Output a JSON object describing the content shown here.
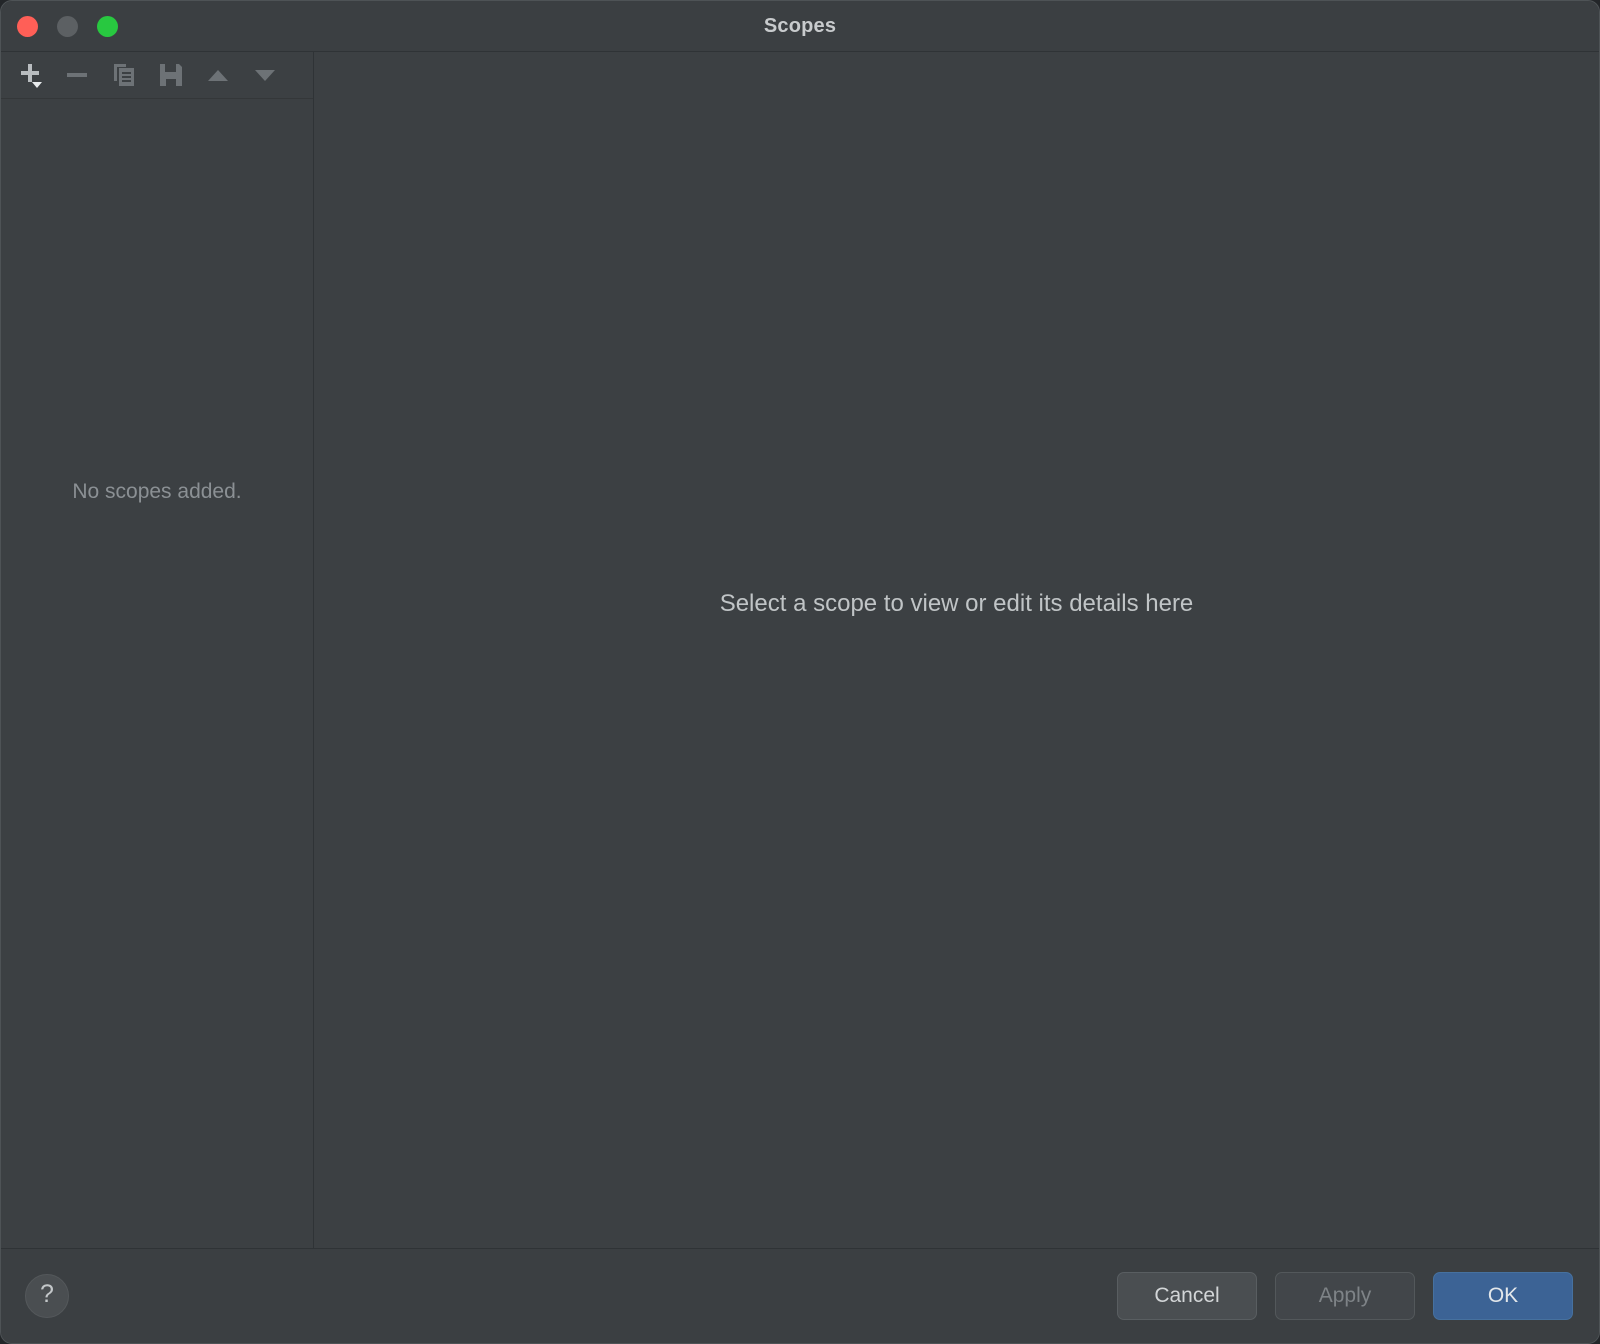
{
  "window": {
    "title": "Scopes",
    "traffic_lights": [
      {
        "name": "close",
        "color": "#ff5f57"
      },
      {
        "name": "minimize",
        "color": "#5c6063"
      },
      {
        "name": "zoom",
        "color": "#28c840"
      }
    ]
  },
  "toolbar": {
    "items": [
      {
        "icon": "add-icon",
        "label": "Add scope",
        "enabled": true,
        "has_dropdown": true
      },
      {
        "icon": "remove-icon",
        "label": "Remove scope",
        "enabled": false,
        "has_dropdown": false
      },
      {
        "icon": "copy-icon",
        "label": "Duplicate scope",
        "enabled": false,
        "has_dropdown": false
      },
      {
        "icon": "save-icon",
        "label": "Save scope",
        "enabled": false,
        "has_dropdown": false
      },
      {
        "icon": "move-up-icon",
        "label": "Move up",
        "enabled": false,
        "has_dropdown": false
      },
      {
        "icon": "move-down-icon",
        "label": "Move down",
        "enabled": false,
        "has_dropdown": false
      }
    ]
  },
  "left_panel": {
    "empty_message": "No scopes added."
  },
  "right_panel": {
    "placeholder": "Select a scope to view or edit its details here"
  },
  "footer": {
    "help_label": "?",
    "buttons": [
      {
        "label": "Cancel",
        "state": "normal"
      },
      {
        "label": "Apply",
        "state": "disabled"
      },
      {
        "label": "OK",
        "state": "primary"
      }
    ]
  },
  "colors": {
    "window_background": "#3c4043",
    "titlebar_background": "#3b3f42",
    "footer_background": "#3b3f42",
    "divider": "#2f3336",
    "primary_button": "#3c6395",
    "text_primary": "#c8cbcd",
    "text_muted": "#8b9094"
  }
}
